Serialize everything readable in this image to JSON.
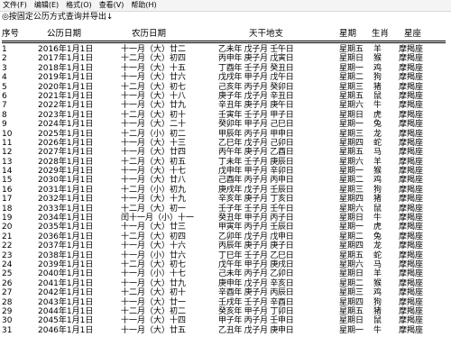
{
  "menu": [
    "文件(F)",
    "编辑(E)",
    "格式(O)",
    "查看(V)",
    "帮助(H)"
  ],
  "notice": "◎按固定公历方式查询并导出↓",
  "headers": {
    "idx": "序号",
    "solar": "公历日期",
    "lunar": "农历日期",
    "ganzhi": "天干地支",
    "week": "星期",
    "zodiac": "生肖",
    "constellation": "星座"
  },
  "rows": [
    [
      "1",
      "2016年1月1日",
      "十一月（大）廿二",
      "乙未年 戊子月 壬午日",
      "星期五",
      "羊",
      "摩羯座"
    ],
    [
      "2",
      "2017年1月1日",
      "十二月（大）初四",
      "丙申年 庚子月 戊寅日",
      "星期日",
      "猴",
      "摩羯座"
    ],
    [
      "3",
      "2018年1月1日",
      "十一月（大）十五",
      "丁酉年 壬子月 癸丑日",
      "星期一",
      "鸡",
      "摩羯座"
    ],
    [
      "4",
      "2019年1月1日",
      "十一月（大）廿六",
      "戊戌年 甲子月 戊午日",
      "星期二",
      "狗",
      "摩羯座"
    ],
    [
      "5",
      "2020年1月1日",
      "十二月（大）初七",
      "己亥年 丙子月 癸卯日",
      "星期三",
      "猪",
      "摩羯座"
    ],
    [
      "6",
      "2021年1月1日",
      "十一月（大）十八",
      "庚子年 戊子月 辛丑日",
      "星期五",
      "鼠",
      "摩羯座"
    ],
    [
      "7",
      "2022年1月1日",
      "十一月（大）廿九",
      "辛丑年 庚子月 庚午日",
      "星期六",
      "牛",
      "摩羯座"
    ],
    [
      "8",
      "2023年1月1日",
      "十二月（大）初十",
      "壬寅年 壬子月 甲子日",
      "星期日",
      "虎",
      "摩羯座"
    ],
    [
      "9",
      "2024年1月1日",
      "十一月（大）二十",
      "癸卯年 甲子月 己巳日",
      "星期一",
      "兔",
      "摩羯座"
    ],
    [
      "10",
      "2025年1月1日",
      "十二月（小）初二",
      "甲辰年 丙子月 甲申日",
      "星期三",
      "龙",
      "摩羯座"
    ],
    [
      "11",
      "2026年1月1日",
      "十一月（大）十三",
      "乙巳年 戊子月 己卯日",
      "星期四",
      "蛇",
      "摩羯座"
    ],
    [
      "12",
      "2027年1月1日",
      "十一月（大）廿四",
      "丙午年 庚子月 乙酉日",
      "星期五",
      "马",
      "摩羯座"
    ],
    [
      "13",
      "2028年1月1日",
      "十二月（大）初五",
      "丁未年 壬子月 庚辰日",
      "星期六",
      "羊",
      "摩羯座"
    ],
    [
      "14",
      "2029年1月1日",
      "十一月（大）十七",
      "戊申年 甲子月 辛卯日",
      "星期一",
      "猴",
      "摩羯座"
    ],
    [
      "15",
      "2030年1月1日",
      "十一月（大）廿八",
      "己酉年 丙子月 丙申日",
      "星期二",
      "鸡",
      "摩羯座"
    ],
    [
      "16",
      "2031年1月1日",
      "十二月（小）初九",
      "庚戌年 戊子月 壬辰日",
      "星期三",
      "狗",
      "摩羯座"
    ],
    [
      "17",
      "2032年1月1日",
      "十一月（大）十九",
      "辛亥年 庚子月 丁亥日",
      "星期四",
      "猪",
      "摩羯座"
    ],
    [
      "18",
      "2033年1月1日",
      "十二月（大）初一",
      "壬子年 壬子月 壬午日",
      "星期六",
      "鼠",
      "摩羯座"
    ],
    [
      "19",
      "2034年1月1日",
      "闰十一月（小）十一",
      "癸丑年 甲子月 丙子日",
      "星期日",
      "牛",
      "摩羯座"
    ],
    [
      "20",
      "2035年1月1日",
      "十一月（大）廿三",
      "甲寅年 丙子月 壬辰日",
      "星期一",
      "虎",
      "摩羯座"
    ],
    [
      "21",
      "2036年1月1日",
      "十二月（大）初四",
      "乙卯年 戊子月 戊申日",
      "星期二",
      "兔",
      "摩羯座"
    ],
    [
      "22",
      "2037年1月1日",
      "十一月（大）十六",
      "丙辰年 庚子月 庚子日",
      "星期四",
      "龙",
      "摩羯座"
    ],
    [
      "23",
      "2038年1月1日",
      "十一月（小）廿六",
      "丁巳年 壬子月 乙巳日",
      "星期五",
      "蛇",
      "摩羯座"
    ],
    [
      "24",
      "2039年1月1日",
      "十二月（大）初七",
      "戊午年 甲子月 庚戌日",
      "星期六",
      "马",
      "摩羯座"
    ],
    [
      "25",
      "2040年1月1日",
      "十一月（小）十七",
      "己未年 丙子月 乙卯日",
      "星期日",
      "羊",
      "摩羯座"
    ],
    [
      "26",
      "2041年1月1日",
      "十一月（大）廿九",
      "庚申年 戊子月 辛亥日",
      "星期二",
      "猴",
      "摩羯座"
    ],
    [
      "27",
      "2042年1月1日",
      "十二月（大）初十",
      "辛酉年 庚子月 丙辰日",
      "星期三",
      "鸡",
      "摩羯座"
    ],
    [
      "28",
      "2043年1月1日",
      "十一月（大）廿一",
      "壬戌年 壬子月 辛酉日",
      "星期四",
      "狗",
      "摩羯座"
    ],
    [
      "29",
      "2044年1月1日",
      "十二月（大）初二",
      "癸亥年 甲子月 丁卯日",
      "星期五",
      "猪",
      "摩羯座"
    ],
    [
      "30",
      "2045年1月1日",
      "十一月（大）十四",
      "甲子年 丙子月 壬申日",
      "星期日",
      "鼠",
      "摩羯座"
    ],
    [
      "31",
      "2046年1月1日",
      "十一月（大）廿五",
      "乙丑年 戊子月 庚申日",
      "星期一",
      "牛",
      "摩羯座"
    ]
  ]
}
